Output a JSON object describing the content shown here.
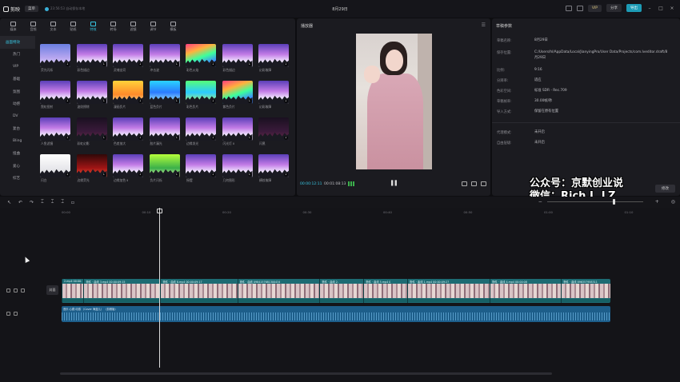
{
  "app": {
    "name": "剪映",
    "menu_label": "菜单",
    "autosave": "23:56:53 自动保存本地",
    "project_title": "8月29日",
    "vip_label": "VIP",
    "share_label": "分享",
    "export_label": "导出"
  },
  "library": {
    "tabs": [
      {
        "label": "媒体",
        "icon": "media-icon"
      },
      {
        "label": "音频",
        "icon": "audio-icon"
      },
      {
        "label": "文本",
        "icon": "text-icon"
      },
      {
        "label": "贴纸",
        "icon": "sticker-icon"
      },
      {
        "label": "特效",
        "icon": "effects-icon",
        "active": true
      },
      {
        "label": "转场",
        "icon": "transition-icon"
      },
      {
        "label": "滤镜",
        "icon": "filter-icon"
      },
      {
        "label": "调节",
        "icon": "adjust-icon"
      },
      {
        "label": "模板",
        "icon": "template-icon"
      }
    ],
    "categories": [
      "画面特效",
      "热门",
      "VIP",
      "基础",
      "氛围",
      "动感",
      "DV",
      "复古",
      "Bling",
      "扭曲",
      "爱心",
      "综艺"
    ],
    "tiles": [
      {
        "name": "荧光闪烁",
        "style": "blue"
      },
      {
        "name": "彩色描边",
        "style": "purple"
      },
      {
        "name": "灵魂出窍",
        "style": "purple"
      },
      {
        "name": "冲击波",
        "style": "purple"
      },
      {
        "name": "彩色火焰",
        "style": "rainbow"
      },
      {
        "name": "彩色描边",
        "style": "purple"
      },
      {
        "name": "幻彩故障",
        "style": "purple"
      },
      {
        "name": "霓虹投射",
        "style": "purple"
      },
      {
        "name": "波纹擦除",
        "style": "purple"
      },
      {
        "name": "漫画负片",
        "style": "yellow"
      },
      {
        "name": "蓝色负片",
        "style": "cyan"
      },
      {
        "name": "彩色负片",
        "style": "green"
      },
      {
        "name": "紫色负片",
        "style": "rainbow"
      },
      {
        "name": "幻彩故障",
        "style": "purple"
      },
      {
        "name": "人鱼滤镜",
        "style": "purple"
      },
      {
        "name": "彩虹幻影",
        "style": "dark"
      },
      {
        "name": "色差放大",
        "style": "purple"
      },
      {
        "name": "胶片漏光",
        "style": "purple"
      },
      {
        "name": "边缘发光",
        "style": "purple"
      },
      {
        "name": "闪光灯 Ⅱ",
        "style": "purple"
      },
      {
        "name": "闪黑",
        "style": "dark"
      },
      {
        "name": "闪白",
        "style": "white"
      },
      {
        "name": "边缘荧光",
        "style": "red"
      },
      {
        "name": "边缘加色 Ⅱ",
        "style": "purple"
      },
      {
        "name": "负片闪烁",
        "style": "lime"
      },
      {
        "name": "摇摆",
        "style": "purple"
      },
      {
        "name": "几何图形",
        "style": "purple"
      },
      {
        "name": "横纹故障",
        "style": "purple"
      }
    ]
  },
  "player": {
    "title": "播放器",
    "time_current": "00:00:12:11",
    "time_total": "00:01:08:13"
  },
  "draft": {
    "title": "草稿参数",
    "rows": [
      {
        "k": "草稿名称:",
        "v": "8月29日"
      },
      {
        "k": "保存位置:",
        "v": "C:/Users/hl/AppData/Local/JianyingPro/User Data/Projects/com.lveditor.draft/8月29日"
      },
      {
        "k": "比例:",
        "v": "9:16"
      },
      {
        "k": "分辨率:",
        "v": "适应"
      },
      {
        "k": "色彩空间:",
        "v": "标准 SDR - Rec.709"
      },
      {
        "k": "草稿帧率:",
        "v": "30.00帧/秒"
      },
      {
        "k": "导入方式:",
        "v": "保留在原有位置"
      },
      {
        "k": "代理模式:",
        "v": "未开启"
      },
      {
        "k": "自由层级:",
        "v": "未开启"
      }
    ],
    "edit_label": "修改"
  },
  "watermark": {
    "line1": "公众号：京默创业说",
    "line2": "微信：Rich L_LZ"
  },
  "timeline": {
    "ruler_labels": [
      "00:00",
      "00:10",
      "00:20",
      "00:30",
      "00:40",
      "00:50",
      "01:00",
      "01:10"
    ],
    "cover_label": "封面",
    "clips": [
      {
        "label": "2.mp4  00:00:",
        "start": 0,
        "end": 0.04
      },
      {
        "label": "物件 · 曲线  3.mp4  00:00:09:15",
        "start": 0.04,
        "end": 0.18
      },
      {
        "label": "物件 · 曲线  8.mp4  00:00:09:17",
        "start": 0.18,
        "end": 0.32
      },
      {
        "label": "物件 · 曲线  0984157681300434",
        "start": 0.32,
        "end": 0.47
      },
      {
        "label": "物件 · 曲线  2.",
        "start": 0.47,
        "end": 0.55
      },
      {
        "label": "物件 · 曲线  5.mp4  0",
        "start": 0.55,
        "end": 0.63
      },
      {
        "label": "物件 · 曲线  1.mp4  00:00:09:27",
        "start": 0.63,
        "end": 0.78
      },
      {
        "label": "物件 · 曲线  4.mp4  00:00:08",
        "start": 0.78,
        "end": 0.91
      },
      {
        "label": "物件 · 曲线  896357958311",
        "start": 0.91,
        "end": 1
      }
    ],
    "audio_label": "音乐 心跳·动感 （Cover 海蓝儿） （剪辑版）",
    "playhead_fraction": 0.16
  }
}
